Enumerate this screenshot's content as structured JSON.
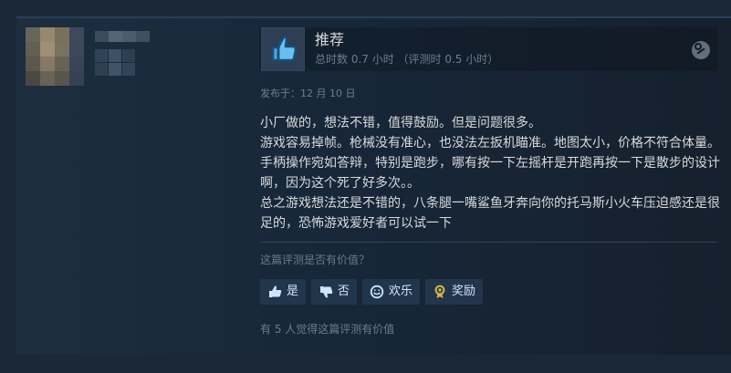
{
  "review": {
    "verdict": "推荐",
    "hours": "总时数 0.7 小时 （评测时 0.5 小时）",
    "posted": "发布于：12 月 10 日",
    "body": [
      "小厂做的，想法不错，值得鼓励。但是问题很多。",
      "游戏容易掉帧。枪械没有准心，也没法左扳机瞄准。地图太小，价格不符合体量。手柄操作宛如答辩，特别是跑步，哪有按一下左摇杆是开跑再按一下是散步的设计啊，因为这个死了好多次。。",
      "总之游戏想法还是不错的，八条腿一嘴鲨鱼牙奔向你的托马斯小火车压迫感还是很足的，恐怖游戏爱好者可以试一下"
    ],
    "question": "这篇评测是否有价值？",
    "helpful": "有 5 人觉得这篇评测有价值"
  },
  "actions": {
    "yes": "是",
    "no": "否",
    "funny": "欢乐",
    "award": "奖励"
  },
  "icons": {
    "thumb": "thumbs-up-icon",
    "steam": "steam-icon",
    "yes": "thumbs-up-icon",
    "no": "thumbs-down-icon",
    "funny": "smile-icon",
    "award": "award-icon"
  },
  "colors": {
    "background": "#1b2838",
    "card": "#17283a",
    "accent": "#4fa3e5",
    "text": "#d9dadc",
    "muted": "#6b7d91",
    "button": "#22364b",
    "buttonText": "#cfe6ff",
    "award": "#d6b44a"
  }
}
